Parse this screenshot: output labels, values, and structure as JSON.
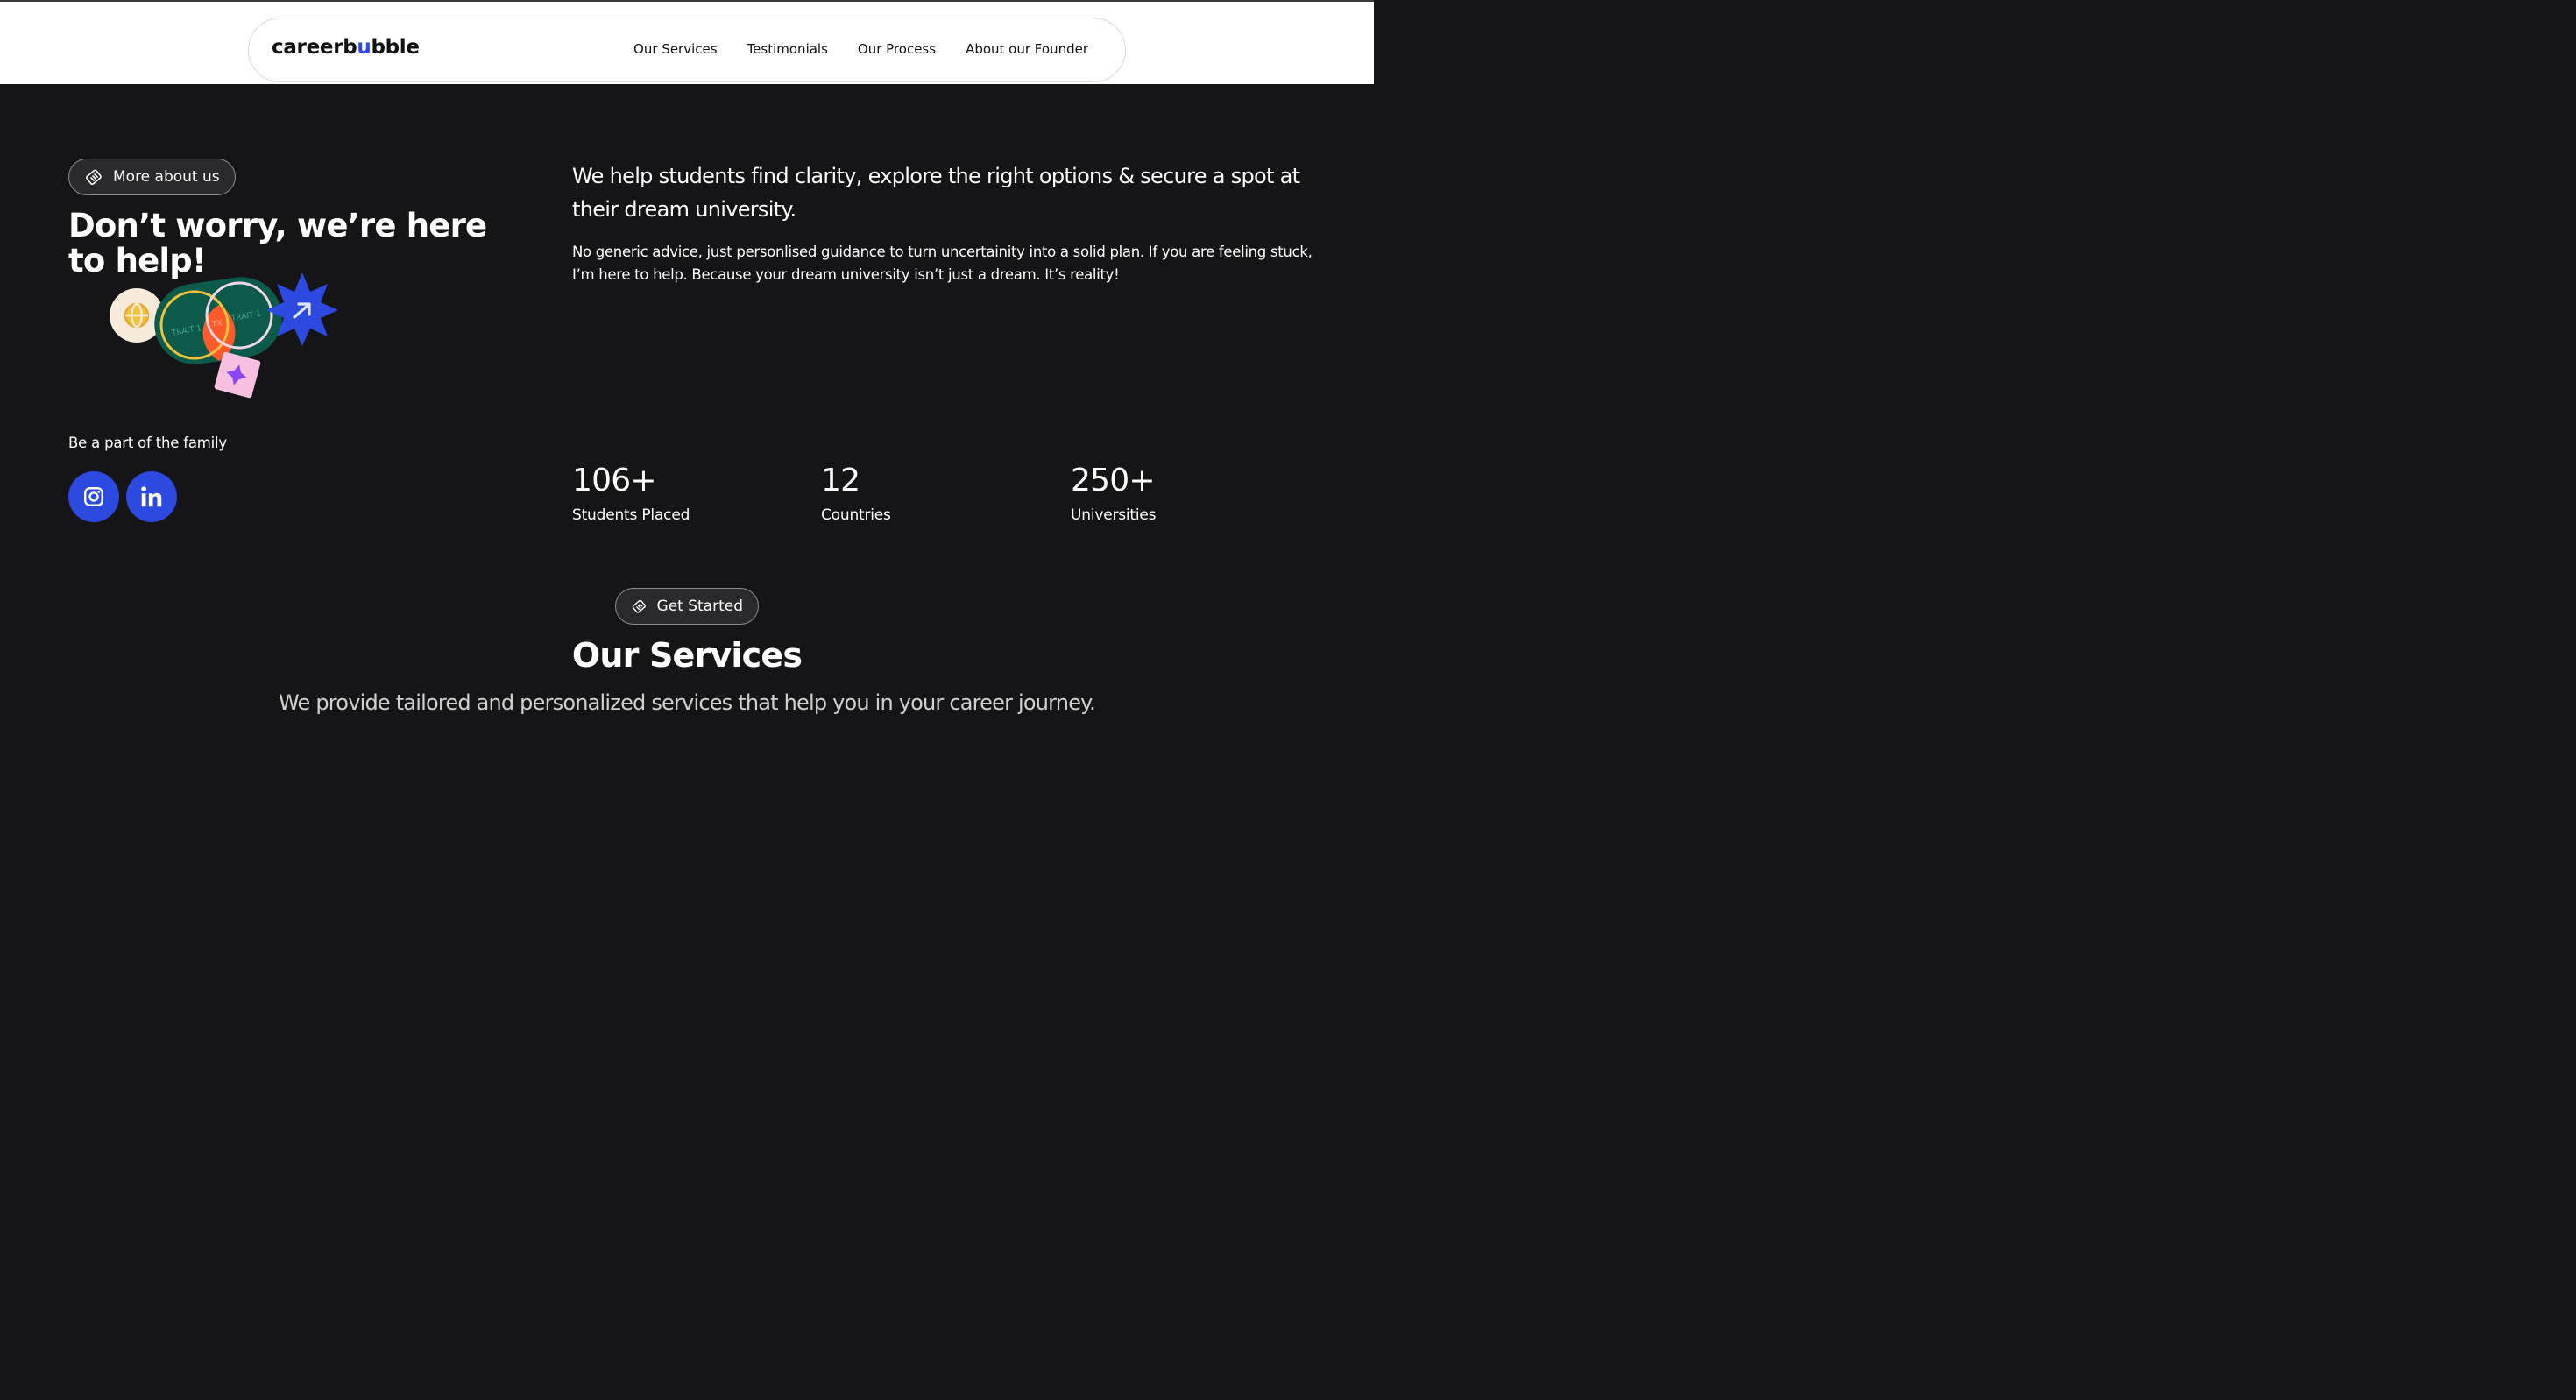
{
  "brand": {
    "logo_prefix": "careerb",
    "logo_accent": "u",
    "logo_suffix": "bble",
    "accent_color": "#2f47e0"
  },
  "nav": {
    "links": [
      {
        "label": "Our Services"
      },
      {
        "label": "Testimonials"
      },
      {
        "label": "Our Process"
      },
      {
        "label": "About our Founder"
      }
    ]
  },
  "about": {
    "pill_label": "More about us",
    "title": "Don’t worry, we’re here to help!",
    "illustration": {
      "trait_left": "TRAIT 1",
      "trait_mid": "TX",
      "trait_right": "TRAIT 1",
      "icons": [
        "globe-icon",
        "arrow-up-right-icon",
        "sparkle-icon"
      ]
    },
    "lead": "We help students find clarity, explore the right options & secure a spot at their dream university.",
    "body": "No generic advice, just personlised guidance to turn uncertainity into a solid plan. If you are feeling stuck, I’m here to help. Because your dream university isn’t just a dream. It’s reality!"
  },
  "family": {
    "label": "Be a part of the family",
    "social": [
      {
        "icon": "instagram-icon"
      },
      {
        "icon": "linkedin-icon"
      }
    ]
  },
  "stats": [
    {
      "value": "106+",
      "label": "Students Placed"
    },
    {
      "value": "12",
      "label": "Countries"
    },
    {
      "value": "250+",
      "label": "Universities"
    }
  ],
  "services": {
    "pill_label": "Get Started",
    "title": "Our Services",
    "subtitle": "We provide tailored and personalized services that help you in your career journey."
  }
}
